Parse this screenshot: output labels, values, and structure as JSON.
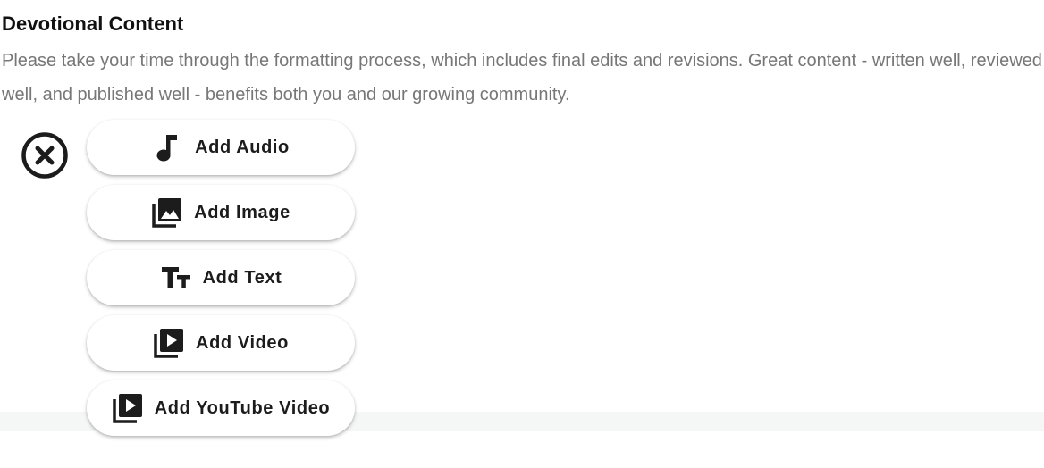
{
  "section": {
    "title": "Devotional Content",
    "description": "Please take your time through the formatting process, which includes final edits and revisions. Great content - written well, reviewed well, and published well - benefits both you and our growing community."
  },
  "menu": {
    "close_icon": "close-circle-icon",
    "items": [
      {
        "label": "Add Audio",
        "icon": "music-note-icon"
      },
      {
        "label": "Add Image",
        "icon": "photo-library-icon"
      },
      {
        "label": "Add Text",
        "icon": "text-size-icon"
      },
      {
        "label": "Add Video",
        "icon": "video-library-icon"
      },
      {
        "label": "Add YouTube Video",
        "icon": "video-library-icon"
      }
    ]
  },
  "colors": {
    "heading": "#111111",
    "description": "#777777",
    "button_text": "#1c1c1c",
    "icon": "#1c1c1c"
  }
}
